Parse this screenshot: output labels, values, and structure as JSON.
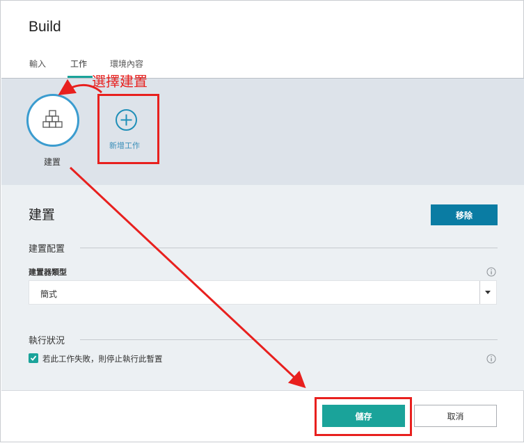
{
  "dialog": {
    "title": "Build"
  },
  "tabs": [
    {
      "label": "輸入"
    },
    {
      "label": "工作",
      "active": true
    },
    {
      "label": "環境內容"
    }
  ],
  "jobs": {
    "current": {
      "label": "建置",
      "icon": "builder-blocks-icon"
    },
    "add": {
      "label": "新增工作",
      "icon": "plus-circle-icon"
    }
  },
  "annotation": {
    "text": "選擇建置",
    "color": "#e8201e"
  },
  "section": {
    "title": "建置",
    "remove_label": "移除",
    "config_group": "建置配置",
    "builder_type_label": "建置器類型",
    "builder_type_value": "簡式",
    "status_group": "執行狀況",
    "stop_on_fail_label": "若此工作失敗，則停止執行此暫置",
    "stop_on_fail_checked": true
  },
  "footer": {
    "save_label": "儲存",
    "cancel_label": "取消"
  },
  "colors": {
    "accent": "#1aa39a",
    "remove_button": "#0a7ca3",
    "job_ring": "#3b9ccf",
    "annotation_red": "#e8201e"
  }
}
